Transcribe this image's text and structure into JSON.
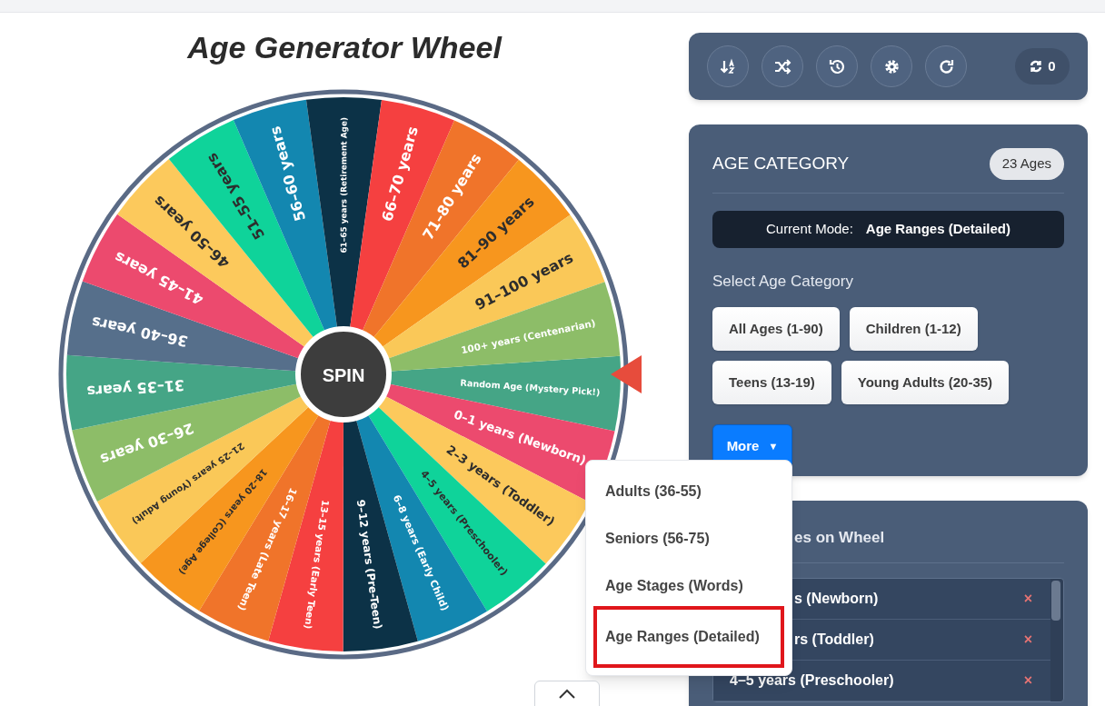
{
  "title": "Age Generator Wheel",
  "wheel": {
    "spin_label": "SPIN",
    "segments": [
      {
        "label": "Random Age (Mystery Pick!)",
        "color": "#45a586",
        "kind": "light"
      },
      {
        "label": "0–1 years (Newborn)",
        "color": "#ec4a6e",
        "kind": "light"
      },
      {
        "label": "2–3 years (Toddler)",
        "color": "#fcc95c",
        "kind": "dark"
      },
      {
        "label": "4–5 years (Preschooler)",
        "color": "#0fd39a",
        "kind": "dark"
      },
      {
        "label": "6–8 years (Early Child)",
        "color": "#1387b0",
        "kind": "light"
      },
      {
        "label": "9–12 years (Pre-Teen)",
        "color": "#0c3247",
        "kind": "light"
      },
      {
        "label": "13–15 years (Early Teen)",
        "color": "#f54040",
        "kind": "light"
      },
      {
        "label": "16–17 years (Late Teen)",
        "color": "#f0742a",
        "kind": "light"
      },
      {
        "label": "18–20 years (College Age)",
        "color": "#f7961e",
        "kind": "dark"
      },
      {
        "label": "21–25 years (Young Adult)",
        "color": "#fac858",
        "kind": "dark"
      },
      {
        "label": "26–30 years",
        "color": "#8dbd68",
        "kind": "light"
      },
      {
        "label": "31–35 years",
        "color": "#45a586",
        "kind": "light"
      },
      {
        "label": "36–40 years",
        "color": "#566f8b",
        "kind": "light"
      },
      {
        "label": "41–45 years",
        "color": "#ec4a6e",
        "kind": "light"
      },
      {
        "label": "46–50 years",
        "color": "#fcc95c",
        "kind": "dark"
      },
      {
        "label": "51–55 years",
        "color": "#0fd39a",
        "kind": "dark"
      },
      {
        "label": "56–60 years",
        "color": "#1387b0",
        "kind": "light"
      },
      {
        "label": "61–65 years (Retirement Age)",
        "color": "#0c3247",
        "kind": "light"
      },
      {
        "label": "66–70 years",
        "color": "#f54040",
        "kind": "light"
      },
      {
        "label": "71–80 years",
        "color": "#f0742a",
        "kind": "light"
      },
      {
        "label": "81–90 years",
        "color": "#f7961e",
        "kind": "dark"
      },
      {
        "label": "91–100 years",
        "color": "#fac858",
        "kind": "dark"
      },
      {
        "label": "100+ years (Centenarian)",
        "color": "#8dbd68",
        "kind": "light"
      }
    ]
  },
  "toolbar": {
    "buttons": [
      {
        "kind": "sort"
      },
      {
        "kind": "shuffle"
      },
      {
        "kind": "history"
      },
      {
        "kind": "settings"
      },
      {
        "kind": "redo"
      }
    ],
    "counter": "0"
  },
  "category_panel": {
    "heading": "AGE CATEGORY",
    "count": "23 Ages",
    "mode_label": "Current Mode:",
    "mode_value": "Age Ranges (Detailed)",
    "select_label": "Select Age Category",
    "options": [
      {
        "label": "All Ages (1-90)",
        "selected": false
      },
      {
        "label": "Children (1-12)",
        "selected": false
      },
      {
        "label": "Teens (13-19)",
        "selected": false
      },
      {
        "label": "Young Adults (20-35)",
        "selected": false
      }
    ],
    "more": {
      "label": "More",
      "caret": "▼",
      "selected": true,
      "expanded": true
    }
  },
  "dropdown": {
    "items": [
      {
        "label": "Adults (36-55)",
        "selected": false
      },
      {
        "label": "Seniors (56-75)",
        "selected": false
      },
      {
        "label": "Age Stages (Words)",
        "selected": false
      },
      {
        "label": "Age Ranges (Detailed)",
        "selected": true
      }
    ]
  },
  "wheel_list": {
    "heading": "es on Wheel",
    "rows": [
      {
        "label": "s (Newborn)",
        "remove": "×"
      },
      {
        "label": "rs (Toddler)",
        "remove": "×"
      },
      {
        "label": "4–5 years (Preschooler)",
        "remove": "×"
      }
    ]
  }
}
